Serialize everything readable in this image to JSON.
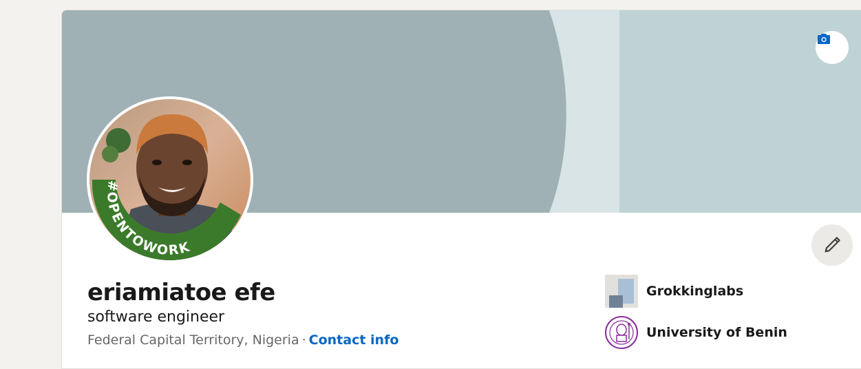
{
  "profile": {
    "name": "eriamiatoe efe",
    "headline": "software engineer",
    "location": "Federal Capital Territory, Nigeria",
    "separator": "·",
    "contact_link": "Contact info",
    "avatar_frame_text": "#OPENTOWORK"
  },
  "organizations": [
    {
      "label": "Grokkinglabs",
      "logo_icon": "company-logo-icon"
    },
    {
      "label": "University of Benin",
      "logo_icon": "university-seal-icon"
    }
  ],
  "controls": {
    "banner_camera_icon": "camera-icon",
    "edit_icon": "pencil-icon"
  },
  "colors": {
    "link": "#0a66c2",
    "open_to_work_green": "#3b7a2a",
    "banner_dark": "#9fb1b5",
    "banner_light": "#bfd3d6"
  }
}
